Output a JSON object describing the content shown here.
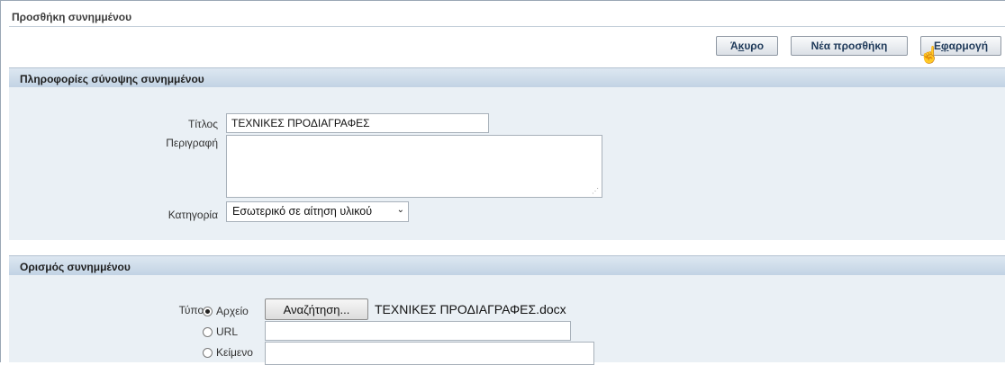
{
  "page": {
    "title": "Προσθήκη συνημμένου"
  },
  "toolbar": {
    "cancel_label_access": "Ά",
    "cancel_label_key": "κ",
    "cancel_label_rest": "υρο",
    "add_another_label": "Νέα προσθήκη",
    "apply_label_before": "Ε",
    "apply_label_key": "φ",
    "apply_label_rest": "αρμογή"
  },
  "summary": {
    "header": "Πληροφορίες σύνοψης συνημμένου",
    "title_label": "Τίτλος",
    "title_value": "ΤΕΧΝΙΚΕΣ ΠΡΟΔΙΑΓΡΑΦΕΣ",
    "description_label": "Περιγραφή",
    "description_value": "",
    "category_label": "Κατηγορία",
    "category_value": "Εσωτερικό σε αίτηση υλικού"
  },
  "definition": {
    "header": "Ορισμός συνημμένου",
    "type_label": "Τύπος",
    "type_options": [
      {
        "label": "Αρχείο",
        "checked": true
      },
      {
        "label": "URL",
        "checked": false
      },
      {
        "label": "Κείμενο",
        "checked": false
      }
    ],
    "browse_label": "Αναζήτηση...",
    "file_name": "ΤΕΧΝΙΚΕΣ ΠΡΟΔΙΑΓΡΑΦΕΣ.docx",
    "url_value": "",
    "text_value": ""
  }
}
